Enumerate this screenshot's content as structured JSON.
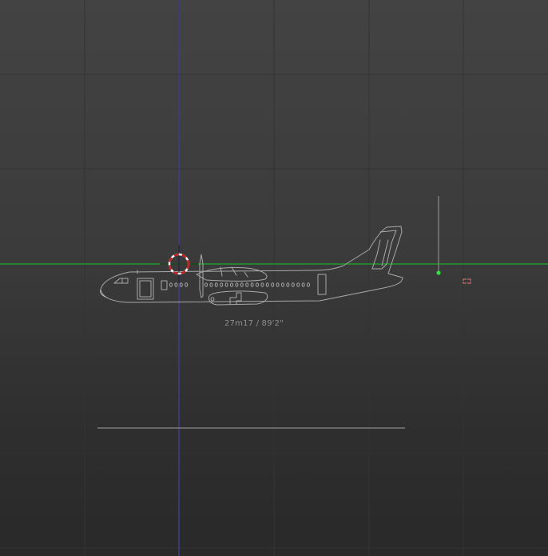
{
  "viewport": {
    "background_top": "#434343",
    "background_bottom": "#292929",
    "grid_color": "#333333",
    "horizon_axis_color": "#1f9a2b",
    "vertical_axis_color": "#3f3b86"
  },
  "model": {
    "outline_color": "#a9a9a9",
    "dimension_label": "27m17 / 89'2\""
  },
  "gizmos": {
    "crosshair_colors": [
      "#c21f1f",
      "#ffffff"
    ],
    "pivot_point_color": "#2ee043",
    "selection_marker_color": "#e07a6e"
  },
  "icons": {
    "crosshair": "origin-crosshair-icon",
    "pivot": "pivot-point-icon",
    "selection": "selection-corner-icon"
  }
}
